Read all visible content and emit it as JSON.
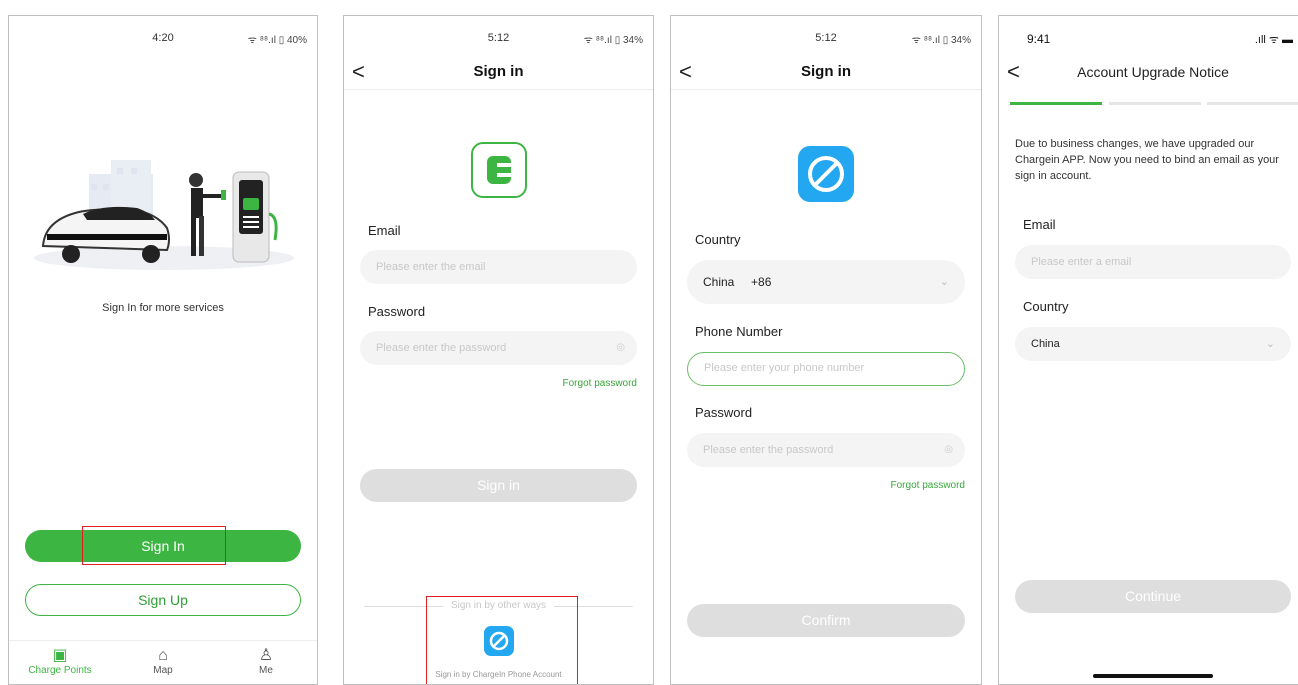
{
  "colors": {
    "brand_green": "#3cb543",
    "highlight_red": "#e0201e",
    "chargein_blue": "#22a7f0"
  },
  "screen1": {
    "status_time": "4:20",
    "status_icons": "ᯤ ⁸⁸.ıl ▯ 40%",
    "tagline": "Sign In for more services",
    "sign_in_button": "Sign In",
    "sign_up_button": "Sign Up",
    "tabs": [
      {
        "label": "Charge Points",
        "icon": "charge-point-icon"
      },
      {
        "label": "Map",
        "icon": "map-icon"
      },
      {
        "label": "Me",
        "icon": "person-icon"
      }
    ]
  },
  "screen2": {
    "status_time": "5:12",
    "status_icons": "ᯤ ⁸⁸.ıl ▯ 34%",
    "back": "<",
    "title": "Sign in",
    "email_label": "Email",
    "email_placeholder": "Please enter the email",
    "password_label": "Password",
    "password_placeholder": "Please enter the password",
    "forgot_password": "Forgot password",
    "sign_in_button": "Sign in",
    "other_ways": "Sign in by other ways",
    "phone_account": "Sign in by ChargeIn Phone Account"
  },
  "screen3": {
    "status_time": "5:12",
    "status_icons": "ᯤ ⁸⁸.ıl ▯ 34%",
    "back": "<",
    "title": "Sign in",
    "country_label": "Country",
    "country_value": "China",
    "country_code": "+86",
    "phone_label": "Phone Number",
    "phone_placeholder": "Please enter your phone number",
    "password_label": "Password",
    "password_placeholder": "Please enter the password",
    "forgot_password": "Forgot password",
    "confirm_button": "Confirm"
  },
  "screen4": {
    "status_time": "9:41",
    "status_icons": ".ıll ᯤ ▬",
    "back": "<",
    "title": "Account Upgrade Notice",
    "notice": "Due to business changes, we have upgraded our Chargein APP. Now you need to bind an email as your sign in account.",
    "email_label": "Email",
    "email_placeholder": "Please enter a email",
    "country_label": "Country",
    "country_value": "China",
    "continue_button": "Continue"
  }
}
